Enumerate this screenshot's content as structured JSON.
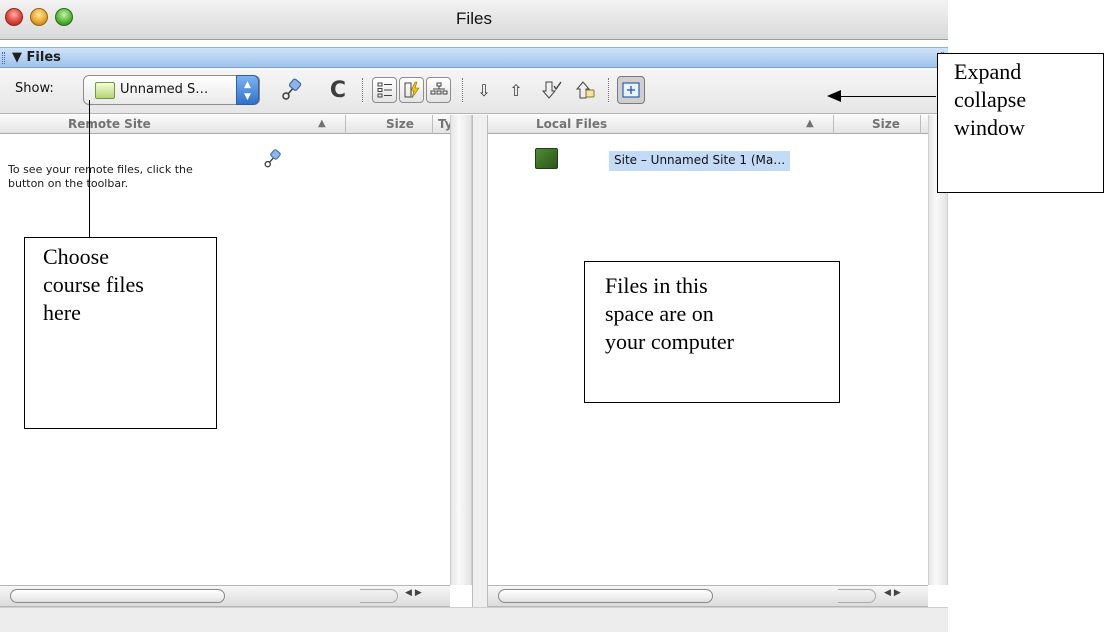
{
  "window": {
    "title": "Files"
  },
  "panel": {
    "title": "▼ Files"
  },
  "toolbar": {
    "show_label": "Show:",
    "site_select_value": "Unnamed S…",
    "icons": {
      "connect": "connect-icon",
      "refresh": "refresh-icon",
      "expand": "expand-collapse-icon"
    }
  },
  "remote_pane": {
    "columns": [
      "Remote Site",
      "Size",
      "Ty"
    ],
    "message_line1": "To see your remote files, click the",
    "message_line2": "button on the toolbar."
  },
  "local_pane": {
    "columns": [
      "Local Files",
      "Size"
    ],
    "items": [
      {
        "label": "Site – Unnamed Site 1 (Ma…",
        "selected": true
      }
    ]
  },
  "annotations": {
    "expand": [
      "Expand",
      "collapse",
      "window"
    ],
    "course": [
      "Choose",
      "course files",
      "here"
    ],
    "local": [
      "Files in this",
      "space are on",
      "your computer"
    ]
  },
  "colors": {
    "panel_bar": "#9ec3ec",
    "selection": "#c4dbf8",
    "site_icon": "#3f7a28"
  }
}
